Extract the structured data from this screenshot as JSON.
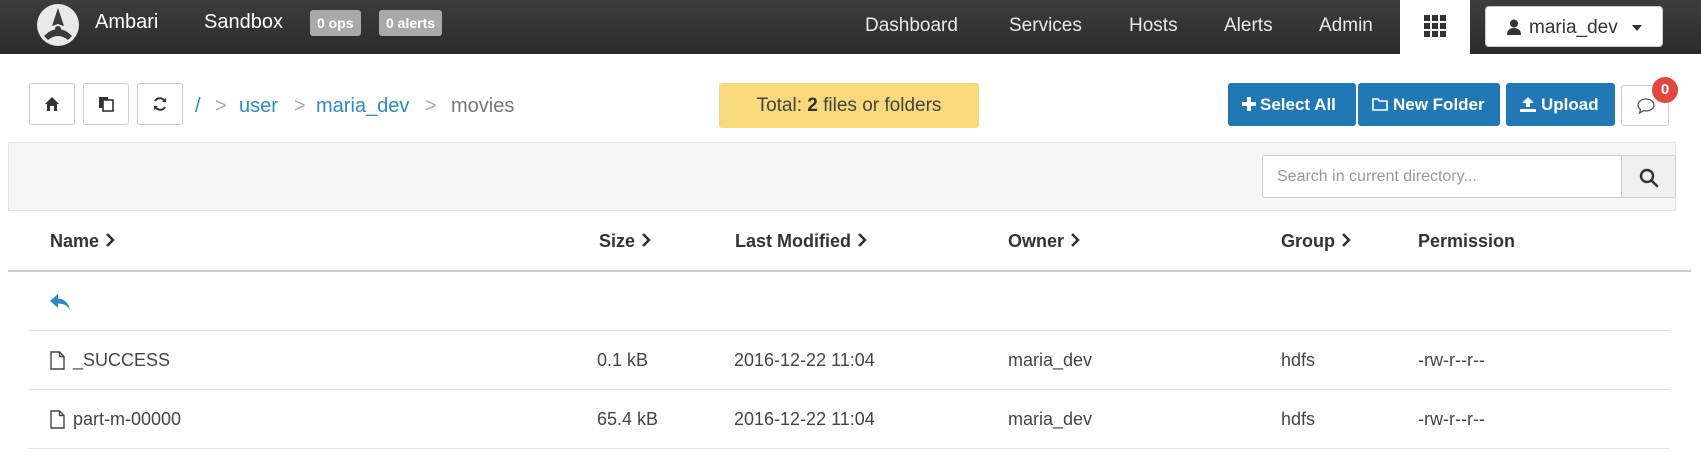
{
  "topbar": {
    "brand": "Ambari",
    "cluster": "Sandbox",
    "ops_badge": "0 ops",
    "alerts_badge": "0 alerts",
    "nav": [
      "Dashboard",
      "Services",
      "Hosts",
      "Alerts",
      "Admin"
    ],
    "user_menu": "maria_dev"
  },
  "breadcrumb": {
    "root": "/",
    "separator": ">",
    "parts": [
      "user",
      "maria_dev",
      "movies"
    ]
  },
  "summary": {
    "prefix": "Total: ",
    "count": "2",
    "suffix": " files or folders"
  },
  "actions": {
    "select_all": "Select All",
    "new_folder": "New Folder",
    "upload": "Upload",
    "notifications": "0"
  },
  "search": {
    "placeholder": "Search in current directory..."
  },
  "table": {
    "columns": [
      "Name",
      "Size",
      "Last Modified",
      "Owner",
      "Group",
      "Permission"
    ],
    "rows": [
      {
        "name": "_SUCCESS",
        "size": "0.1 kB",
        "modified": "2016-12-22 11:04",
        "owner": "maria_dev",
        "group": "hdfs",
        "permission": "-rw-r--r--"
      },
      {
        "name": "part-m-00000",
        "size": "65.4 kB",
        "modified": "2016-12-22 11:04",
        "owner": "maria_dev",
        "group": "hdfs",
        "permission": "-rw-r--r--"
      }
    ]
  },
  "colors": {
    "primary": "#2078b4",
    "link": "#2d8ac7",
    "summary_bg": "#f7d87b",
    "notification": "#e0473d",
    "topbar": "#333333"
  },
  "icons": [
    "ambari-logo-icon",
    "apps-grid-icon",
    "user-icon",
    "caret-down-icon",
    "home-icon",
    "copy-icon",
    "refresh-icon",
    "plus-icon",
    "folder-icon",
    "upload-icon",
    "chat-icon",
    "search-icon",
    "chevron-right-icon",
    "back-arrow-icon",
    "file-icon"
  ]
}
